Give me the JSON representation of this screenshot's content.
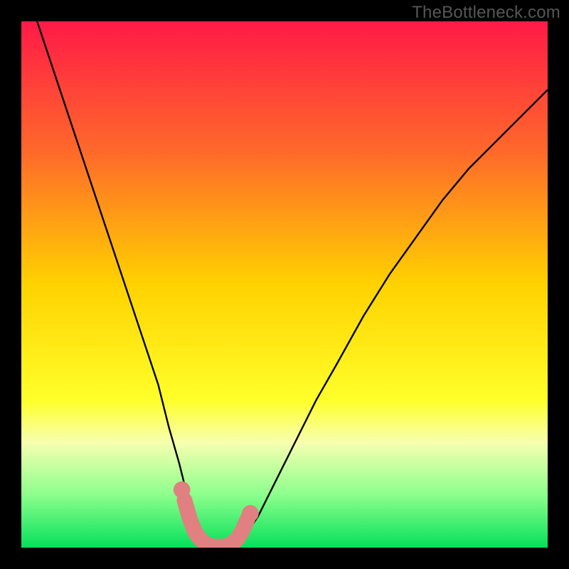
{
  "attribution": "TheBottleneck.com",
  "chart_data": {
    "type": "line",
    "title": "",
    "xlabel": "",
    "ylabel": "",
    "xlim": [
      0,
      100
    ],
    "ylim": [
      0,
      100
    ],
    "background": {
      "type": "vertical-gradient",
      "stops": [
        {
          "offset": 0,
          "color": "#ff1a47"
        },
        {
          "offset": 25,
          "color": "#ff6a2a"
        },
        {
          "offset": 50,
          "color": "#ffd200"
        },
        {
          "offset": 72,
          "color": "#ffff2a"
        },
        {
          "offset": 80,
          "color": "#f7ffb0"
        },
        {
          "offset": 90,
          "color": "#8cff8c"
        },
        {
          "offset": 100,
          "color": "#05e05a"
        }
      ]
    },
    "series": [
      {
        "name": "curve",
        "stroke": "#000000",
        "x": [
          3,
          5,
          8,
          11,
          14,
          17,
          20,
          23,
          26,
          28,
          30,
          31.5,
          33,
          34,
          35,
          36,
          37,
          38,
          39,
          40,
          41,
          42,
          43,
          45,
          48,
          52,
          56,
          60,
          65,
          70,
          75,
          80,
          85,
          90,
          95,
          99,
          100
        ],
        "y": [
          100,
          94,
          85,
          76,
          67,
          58,
          49,
          40,
          31,
          23,
          16,
          10,
          6,
          3,
          1.5,
          0.7,
          0.3,
          0.2,
          0.2,
          0.3,
          0.7,
          1.5,
          3,
          6,
          12,
          20,
          28,
          35,
          44,
          52,
          59,
          66,
          72,
          77,
          82,
          86,
          87
        ]
      },
      {
        "name": "highlight",
        "stroke": "#e08080",
        "style": "thick-round",
        "x": [
          31,
          32,
          33,
          34,
          35,
          36,
          37,
          38,
          39,
          40,
          41,
          42,
          43
        ],
        "y": [
          9,
          5.5,
          3,
          1.6,
          0.8,
          0.3,
          0.2,
          0.2,
          0.3,
          0.8,
          1.6,
          3.2,
          5.5
        ]
      }
    ],
    "markers": [
      {
        "name": "dot-left",
        "x": 30.5,
        "y": 11,
        "r": 1.6,
        "color": "#e08080"
      },
      {
        "name": "dot-right",
        "x": 43.5,
        "y": 6.5,
        "r": 1.6,
        "color": "#e08080"
      }
    ]
  }
}
